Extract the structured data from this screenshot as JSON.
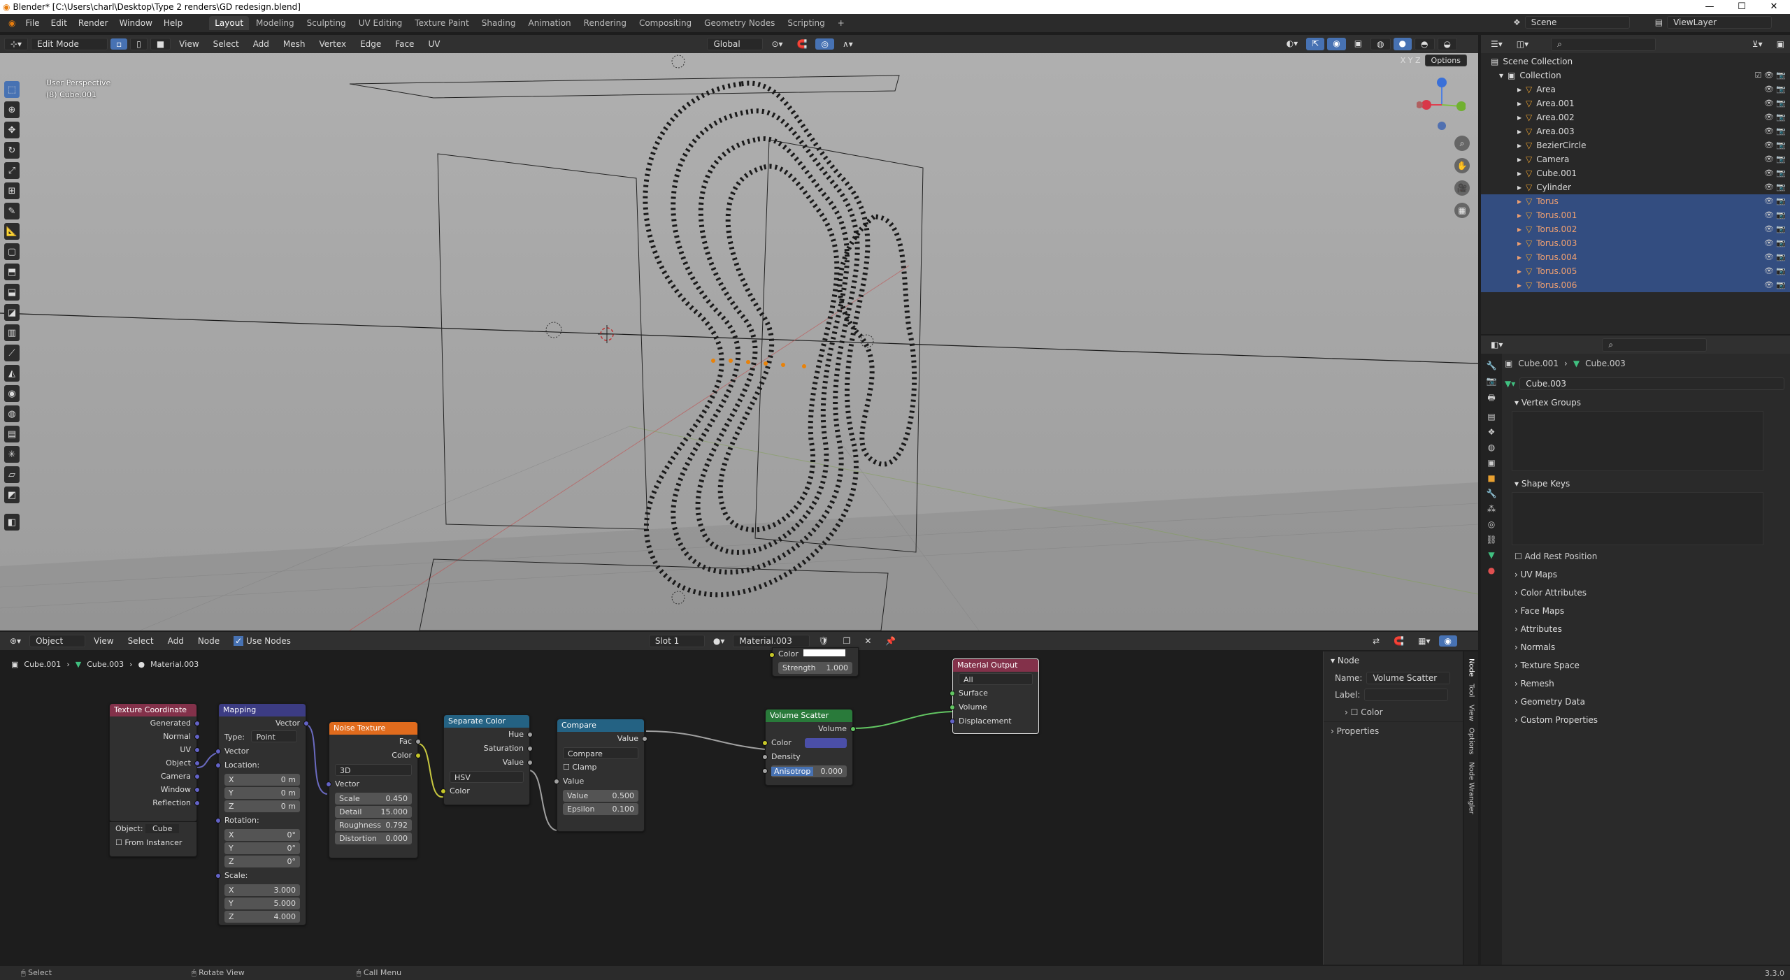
{
  "window": {
    "title": "Blender* [C:\\Users\\charl\\Desktop\\Type 2 renders\\GD redesign.blend]"
  },
  "menu": [
    "File",
    "Edit",
    "Render",
    "Window",
    "Help"
  ],
  "workspaces": [
    "Layout",
    "Modeling",
    "Sculpting",
    "UV Editing",
    "Texture Paint",
    "Shading",
    "Animation",
    "Rendering",
    "Compositing",
    "Geometry Nodes",
    "Scripting"
  ],
  "scene": "Scene",
  "view_layer": "ViewLayer",
  "viewport": {
    "mode": "Edit Mode",
    "menus": [
      "View",
      "Select",
      "Add",
      "Mesh",
      "Vertex",
      "Edge",
      "Face",
      "UV"
    ],
    "transform": "Global",
    "overlay_1": "User Perspective",
    "overlay_2": "(8) Cube.001",
    "options": "Options",
    "axes": "X Y Z"
  },
  "outliner": {
    "root": "Scene Collection",
    "collection": "Collection",
    "items": [
      {
        "name": "Area",
        "sel": false
      },
      {
        "name": "Area.001",
        "sel": false
      },
      {
        "name": "Area.002",
        "sel": false
      },
      {
        "name": "Area.003",
        "sel": false
      },
      {
        "name": "BezierCircle",
        "sel": false
      },
      {
        "name": "Camera",
        "sel": false
      },
      {
        "name": "Cube.001",
        "sel": false
      },
      {
        "name": "Cylinder",
        "sel": false
      },
      {
        "name": "Torus",
        "sel": true
      },
      {
        "name": "Torus.001",
        "sel": true
      },
      {
        "name": "Torus.002",
        "sel": true
      },
      {
        "name": "Torus.003",
        "sel": true
      },
      {
        "name": "Torus.004",
        "sel": true
      },
      {
        "name": "Torus.005",
        "sel": true
      },
      {
        "name": "Torus.006",
        "sel": true
      }
    ]
  },
  "properties": {
    "crumb_obj": "Cube.001",
    "crumb_mesh": "Cube.003",
    "mesh_name": "Cube.003",
    "vertex_groups": "Vertex Groups",
    "shape_keys": "Shape Keys",
    "add_rest": "Add Rest Position",
    "panels": [
      "UV Maps",
      "Color Attributes",
      "Face Maps",
      "Attributes",
      "Normals",
      "Texture Space",
      "Remesh",
      "Geometry Data",
      "Custom Properties"
    ]
  },
  "node_editor": {
    "object": "Object",
    "menus": [
      "View",
      "Select",
      "Add",
      "Node"
    ],
    "use_nodes": "Use Nodes",
    "slot": "Slot 1",
    "material": "Material.003",
    "crumb": [
      "Cube.001",
      "Cube.003",
      "Material.003"
    ]
  },
  "nodes": {
    "texcoord": {
      "title": "Texture Coordinate",
      "outs": [
        "Generated",
        "Normal",
        "UV",
        "Object",
        "Camera",
        "Window",
        "Reflection"
      ],
      "obj_label": "Object:",
      "obj_val": "Cube",
      "from_inst": "From Instancer"
    },
    "mapping": {
      "title": "Mapping",
      "out": "Vector",
      "type_label": "Type:",
      "type": "Point",
      "vec": "Vector",
      "loc": "Location:",
      "rot": "Rotation:",
      "scale": "Scale:",
      "lx": "0 m",
      "ly": "0 m",
      "lz": "0 m",
      "rx": "0°",
      "ry": "0°",
      "rz": "0°",
      "sx": "3.000",
      "sy": "5.000",
      "sz": "4.000"
    },
    "noise": {
      "title": "Noise Texture",
      "fac": "Fac",
      "color": "Color",
      "dim": "3D",
      "vec": "Vector",
      "scale": "0.450",
      "detail": "15.000",
      "rough": "0.792",
      "dist": "0.000",
      "scale_l": "Scale",
      "detail_l": "Detail",
      "rough_l": "Roughness",
      "dist_l": "Distortion"
    },
    "sepcol": {
      "title": "Separate Color",
      "hue": "Hue",
      "sat": "Saturation",
      "val": "Value",
      "mode": "HSV",
      "color": "Color"
    },
    "compare": {
      "title": "Compare",
      "out": "Value",
      "op": "Compare",
      "clamp": "Clamp",
      "in": "Value",
      "v_l": "Value",
      "v": "0.500",
      "e_l": "Epsilon",
      "e": "0.100"
    },
    "volscatter": {
      "title": "Volume Scatter",
      "out": "Volume",
      "color": "Color",
      "density": "Density",
      "aniso_l": "Anisotrop",
      "aniso": "0.000"
    },
    "emission": {
      "color": "Color",
      "strength_l": "Strength",
      "strength": "1.000"
    },
    "matout": {
      "title": "Material Output",
      "target": "All",
      "surface": "Surface",
      "volume": "Volume",
      "disp": "Displacement"
    }
  },
  "n_panel": {
    "title": "Node",
    "name_l": "Name:",
    "name": "Volume Scatter",
    "label_l": "Label:",
    "color": "Color",
    "props": "Properties",
    "tabs": [
      "Node",
      "Tool",
      "View",
      "Options",
      "Node Wrangler"
    ]
  },
  "status": {
    "select": "Select",
    "rotate": "Rotate View",
    "menu": "Call Menu",
    "version": "3.3.0"
  }
}
